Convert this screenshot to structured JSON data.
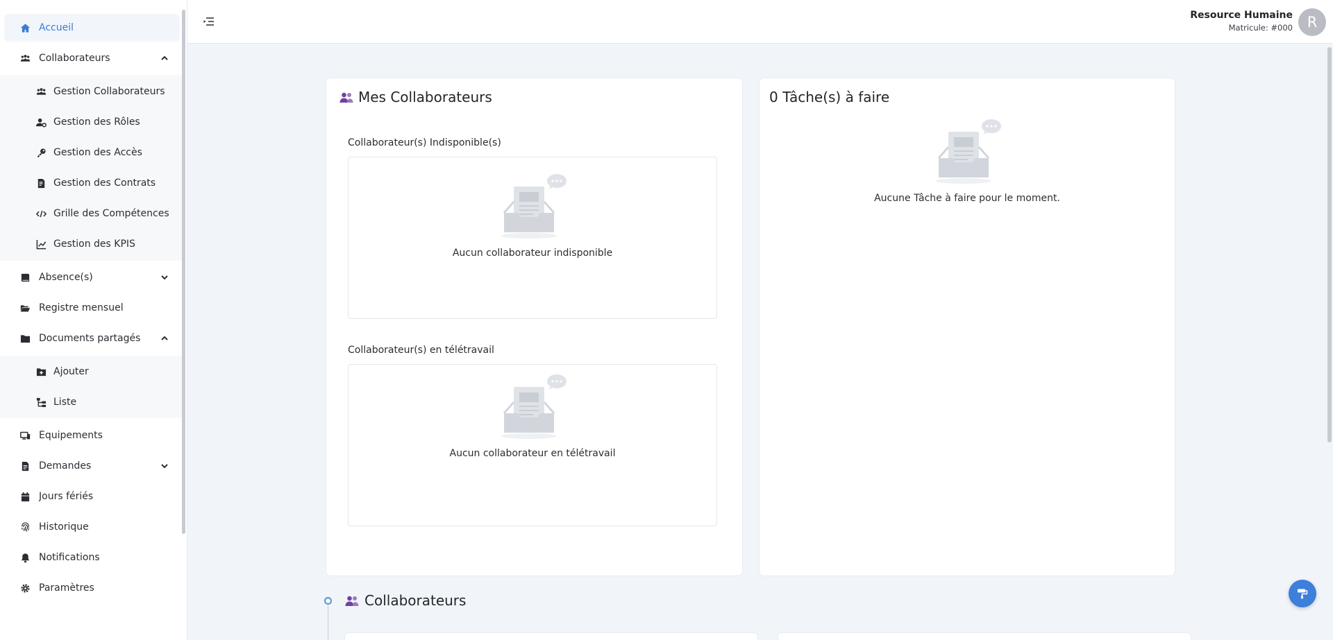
{
  "sidebar": {
    "items": [
      {
        "label": "Accueil",
        "icon": "home-icon"
      },
      {
        "label": "Collaborateurs",
        "icon": "users-icon"
      },
      {
        "label": "Gestion Collaborateurs",
        "icon": "users-icon"
      },
      {
        "label": "Gestion des Rôles",
        "icon": "user-gear-icon"
      },
      {
        "label": "Gestion des Accès",
        "icon": "key-icon"
      },
      {
        "label": "Gestion des Contrats",
        "icon": "file-contract-icon"
      },
      {
        "label": "Grille des Compétences",
        "icon": "code-icon"
      },
      {
        "label": "Gestion des KPIS",
        "icon": "chart-line-icon"
      },
      {
        "label": "Absence(s)",
        "icon": "book-icon"
      },
      {
        "label": "Registre mensuel",
        "icon": "folder-open-icon"
      },
      {
        "label": "Documents partagés",
        "icon": "folder-icon"
      },
      {
        "label": "Ajouter",
        "icon": "folder-plus-icon"
      },
      {
        "label": "Liste",
        "icon": "list-tree-icon"
      },
      {
        "label": "Équipements",
        "icon": "devices-icon"
      },
      {
        "label": "Demandes",
        "icon": "file-icon"
      },
      {
        "label": "Jours fériés",
        "icon": "calendar-icon"
      },
      {
        "label": "Historique",
        "icon": "fingerprint-icon"
      },
      {
        "label": "Notifications",
        "icon": "bell-icon"
      },
      {
        "label": "Paramètres",
        "icon": "gear-icon"
      }
    ]
  },
  "header": {
    "user_name": "Resource Humaine",
    "user_id": "Matricule: #000",
    "avatar_initial": "R"
  },
  "cards": {
    "collaborators": {
      "title": "Mes Collaborateurs",
      "unavailable_title": "Collaborateur(s) Indisponible(s)",
      "unavailable_empty": "Aucun collaborateur indisponible",
      "remote_title": "Collaborateur(s) en télétravail",
      "remote_empty": "Aucun collaborateur en télétravail"
    },
    "tasks": {
      "title": "0 Tâche(s) à faire",
      "empty": "Aucune Tâche à faire pour le moment."
    }
  },
  "section": {
    "title": "Collaborateurs"
  },
  "colors": {
    "accent": "#3c7bd8",
    "users_icon": "#6f42a0",
    "fab": "#3d7fdb"
  }
}
